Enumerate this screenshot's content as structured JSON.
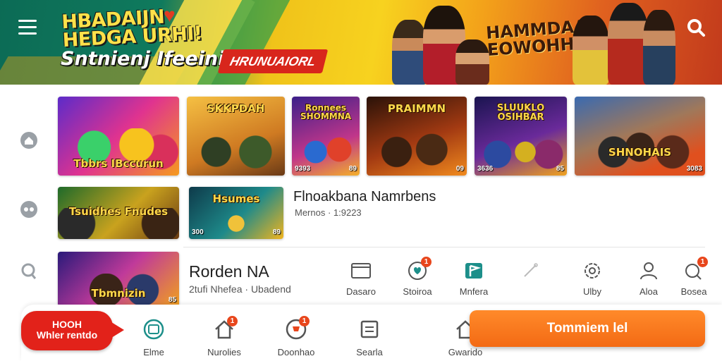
{
  "banner": {
    "logo_line1": "HBADAIJN",
    "logo_line2": "HEDGA URHI!",
    "tagline": "Sntnienj Ifeeinie.",
    "promo_label": "HRUNUAIORL",
    "hero_line1": "HAMMDAA",
    "hero_line2": "EOWOHHA"
  },
  "rail": [
    "home-icon",
    "gamepad-icon",
    "search-person-icon"
  ],
  "row1": [
    {
      "title": "Tbbrs IBccurun",
      "left": "",
      "right": ""
    },
    {
      "title": "SKKPDAH",
      "left": "",
      "right": ""
    },
    {
      "title": "Ronnees SHOMMNA",
      "left": "9393",
      "right": "89"
    },
    {
      "title": "PRAIMMN",
      "left": "",
      "right": "09"
    },
    {
      "title": "SLUUKLO OSIHBAR",
      "left": "3636",
      "right": "85"
    },
    {
      "title": "SHNOHAIS",
      "left": "",
      "right": "3083"
    }
  ],
  "row2": [
    {
      "title": "Tsuidhes Fnudes",
      "left": "",
      "right": ""
    },
    {
      "title": "Hsumes",
      "left": "300",
      "right": "89"
    }
  ],
  "row2_info": {
    "title": "Flnoakbana Namrbens",
    "subtitle": "Mernos · 1:9223"
  },
  "detail": {
    "thumb_title": "Tbmnizin",
    "thumb_right": "85",
    "title": "Rorden NA",
    "subtitle": "2tufi Nhefea · Ubadend"
  },
  "actions": [
    {
      "label": "Dasaro",
      "icon": "window-icon",
      "badge": ""
    },
    {
      "label": "Stoiroa",
      "icon": "heart-chat-icon",
      "badge": "1"
    },
    {
      "label": "Mnfera",
      "icon": "flag-icon",
      "badge": ""
    },
    {
      "label": "",
      "icon": "pencil-icon",
      "badge": ""
    },
    {
      "label": "Ulby",
      "icon": "settings-icon",
      "badge": ""
    },
    {
      "label": "Aloa",
      "icon": "user-icon",
      "badge": ""
    },
    {
      "label": "Bosea",
      "icon": "notification-icon",
      "badge": "1"
    }
  ],
  "bottom": {
    "bubble_line1": "HOOH",
    "bubble_line2": "Whler rentdo",
    "nav": [
      {
        "label": "Elme",
        "icon": "discover-icon",
        "badge": ""
      },
      {
        "label": "Nurolies",
        "icon": "house-icon",
        "badge": "1"
      },
      {
        "label": "Doonhao",
        "icon": "trophy-icon",
        "badge": "1"
      },
      {
        "label": "Searla",
        "icon": "list-icon",
        "badge": ""
      },
      {
        "label": "Gwarido",
        "icon": "store-icon",
        "badge": ""
      }
    ],
    "cta_label": "Tommiem lel"
  },
  "colors": {
    "accent": "#f36a14",
    "badge": "#e8461c",
    "teal": "#1d8f8a",
    "promo": "#d8261c"
  }
}
